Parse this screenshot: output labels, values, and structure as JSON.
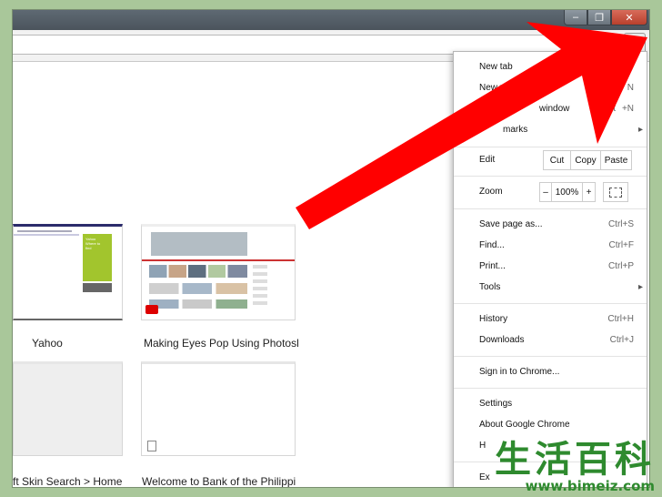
{
  "window_buttons": {
    "minimize": "–",
    "maximize": "❐",
    "close": "✕"
  },
  "tiles": [
    {
      "label": "Yahoo"
    },
    {
      "label": "Making Eyes Pop Using Photosh..."
    },
    {
      "label": "ft Skin Search > Home"
    },
    {
      "label": "Welcome to Bank of the Philippin..."
    }
  ],
  "yahoo_tile_text": [
    "Yahoo",
    "Where to",
    "find"
  ],
  "menu": {
    "new_tab": "New tab",
    "new_window": "New window",
    "new_window_shortcut": "N",
    "new_incognito": "Ne",
    "new_incognito_mid": "window",
    "new_incognito_shortcut_a": "Ct",
    "new_incognito_shortcut_b": "+N",
    "bookmarks": "marks",
    "edit_label": "Edit",
    "cut": "Cut",
    "copy": "Copy",
    "paste": "Paste",
    "zoom_label": "Zoom",
    "zoom_minus": "–",
    "zoom_value": "100%",
    "zoom_plus": "+",
    "save_page": "Save page as...",
    "save_page_shortcut": "Ctrl+S",
    "find": "Find...",
    "find_shortcut": "Ctrl+F",
    "print": "Print...",
    "print_shortcut": "Ctrl+P",
    "tools": "Tools",
    "history": "History",
    "history_shortcut": "Ctrl+H",
    "downloads": "Downloads",
    "downloads_shortcut": "Ctrl+J",
    "sign_in": "Sign in to Chrome...",
    "settings": "Settings",
    "about": "About Google Chrome",
    "help": "H",
    "exit": "Ex"
  },
  "watermark": {
    "chinese": "生活百科",
    "url": "www.bimeiz.com"
  },
  "colors": {
    "arrow": "#ff0000",
    "background": "#a9c79a",
    "watermark": "#2e8a2e"
  }
}
